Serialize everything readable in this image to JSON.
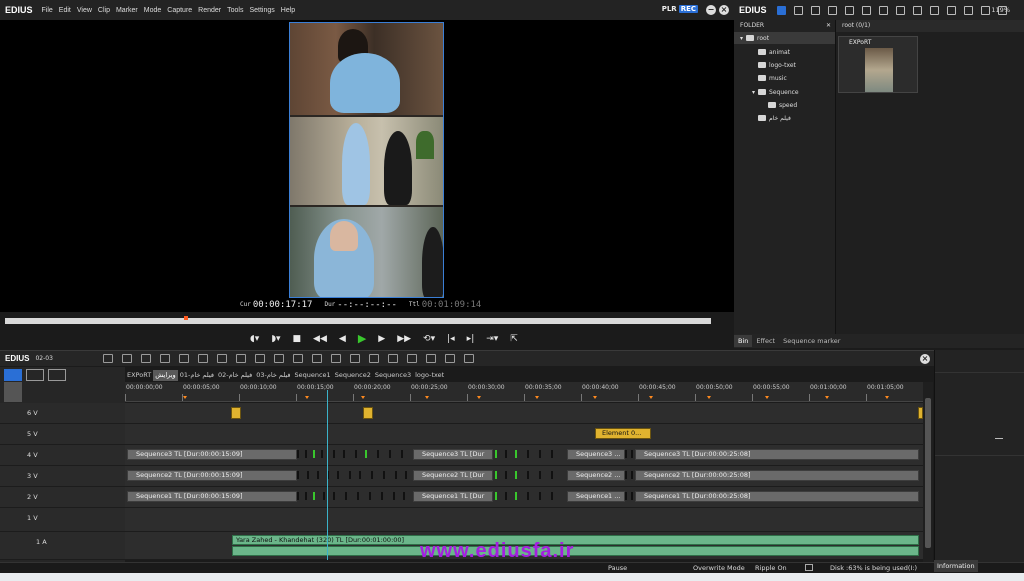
{
  "app": {
    "brand": "EDIUS",
    "menu": [
      "File",
      "Edit",
      "View",
      "Clip",
      "Marker",
      "Mode",
      "Capture",
      "Render",
      "Tools",
      "Settings",
      "Help"
    ],
    "plr": "PLR",
    "rec": "REC"
  },
  "player": {
    "cur_label": "Cur",
    "cur_value": "00:00:17:17",
    "dur_label": "Dur",
    "dur_value": "--:--:--:--",
    "ttl_label": "Ttl",
    "ttl_value": "00:01:09:14"
  },
  "bin": {
    "zoom": "119%",
    "folder_header": "FOLDER",
    "content_header": "root (0/1)",
    "tree": [
      "root",
      "animat",
      "logo-txet",
      "music",
      "Sequence",
      "speed",
      "فیلم خام"
    ],
    "clip_label": "EXPoRT",
    "tabs": [
      "Bin",
      "Effect",
      "Sequence marker"
    ]
  },
  "timeline": {
    "brand": "EDIUS",
    "version": "02-03",
    "seq_tabs": [
      "EXPoRT",
      "ویرایش",
      "فیلم خام-01",
      "فیلم خام-02",
      "فیلم خام-03",
      "Sequence1",
      "Sequence2",
      "Sequence3",
      "logo-txet"
    ],
    "ruler": [
      "00:00:00;00",
      "00:00:05;00",
      "00:00:10;00",
      "00:00:15;00",
      "00:00:20;00",
      "00:00:25;00",
      "00:00:30;00",
      "00:00:35;00",
      "00:00:40;00",
      "00:00:45;00",
      "00:00:50;00",
      "00:00:55;00",
      "00:01:00;00",
      "00:01:05;00"
    ],
    "tracks": {
      "v6": "6 V",
      "v5": "5 V",
      "v4": "4 V",
      "v3": "3 V",
      "v2": "2 V",
      "v1": "1 V",
      "a1": "1 A"
    },
    "element_clip": "Element 0...",
    "seq3_a": "Sequence3  TL [Dur:00:00:15:09]",
    "seq3_b": "Sequence3  TL [Dur",
    "seq3_c": "Sequence3  ...",
    "seq3_d": "Sequence3  TL [Dur:00:00:25:08]",
    "seq2_a": "Sequence2  TL [Dur:00:00:15:09]",
    "seq2_b": "Sequence2  TL [Dur",
    "seq2_c": "Sequence2  ...",
    "seq2_d": "Sequence2  TL [Dur:00:00:25:08]",
    "seq1_a": "Sequence1  TL [Dur:00:00:15:09]",
    "seq1_b": "Sequence1  TL [Dur",
    "seq1_c": "Sequence1  ...",
    "seq1_d": "Sequence1  TL [Dur:00:00:25:08]",
    "audio_clip": "Yara Zahed - Khandehat (320)  TL [Dur:00:01:00:00]"
  },
  "watermark": "www.ediusfa.ir",
  "status": {
    "pause": "Pause",
    "mode": "Overwrite Mode",
    "ripple": "Ripple On",
    "disk": "Disk :63% is being used(I:)",
    "info_tab": "Information"
  },
  "colors": {
    "accent": "#2a6fd6",
    "play": "#39c72d",
    "cursor": "#3bb3c9",
    "watermark": "#a520e0",
    "audio": "#6bb68a"
  }
}
